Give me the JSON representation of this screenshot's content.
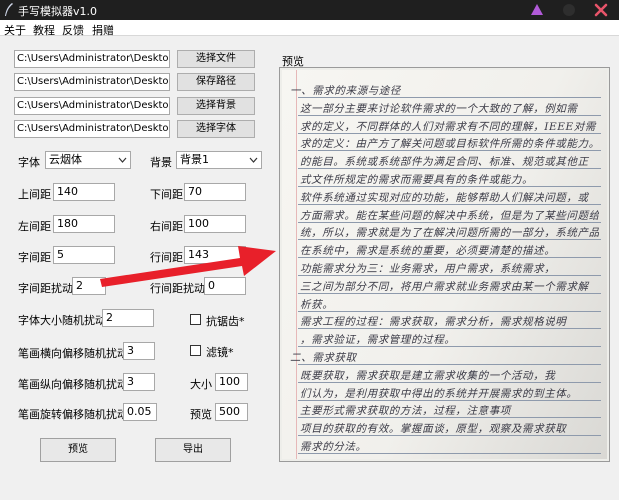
{
  "window": {
    "title": "手写模拟器v1.0"
  },
  "menu": [
    "关于",
    "教程",
    "反馈",
    "捐赠"
  ],
  "files": {
    "rows": [
      {
        "path": "C:\\Users\\Administrator\\Desktop\\我的",
        "button": "选择文件"
      },
      {
        "path": "C:\\Users\\Administrator\\Desktop",
        "button": "保存路径"
      },
      {
        "path": "C:\\Users\\Administrator\\Desktop\\【手",
        "button": "选择背景"
      },
      {
        "path": "C:\\Users\\Administrator\\Desktop\\【手",
        "button": "选择字体"
      }
    ]
  },
  "settings": {
    "font_label": "字体",
    "font_value": "云烟体",
    "bg_label": "背景",
    "bg_value": "背景1",
    "top_margin_label": "上间距",
    "top_margin": "140",
    "bottom_margin_label": "下间距",
    "bottom_margin": "70",
    "left_margin_label": "左间距",
    "left_margin": "180",
    "right_margin_label": "右间距",
    "right_margin": "100",
    "char_spacing_label": "字间距",
    "char_spacing": "5",
    "line_spacing_label": "行间距",
    "line_spacing": "143",
    "char_jitter_label": "字间距扰动",
    "char_jitter": "2",
    "line_jitter_label": "行间距扰动",
    "line_jitter": "0",
    "font_size_jitter_label": "字体大小随机扰动",
    "font_size_jitter": "2",
    "antialias_label": "抗锯齿*",
    "filter_label": "滤镜*",
    "stroke_h_label": "笔画横向偏移随机扰动",
    "stroke_h": "3",
    "stroke_v_label": "笔画纵向偏移随机扰动",
    "stroke_v": "3",
    "size_label": "大小",
    "size": "100",
    "stroke_rot_label": "笔画旋转偏移随机扰动",
    "stroke_rot": "0.05",
    "preview_label": "预览",
    "preview_value": "500"
  },
  "actions": {
    "preview": "预览",
    "export": "导出"
  },
  "preview": {
    "label": "预览",
    "lines": [
      "一、需求的来源与途径",
      "这一部分主要来讨论软件需求的一个大致的了解，例如需",
      "求的定义，不同群体的人们对需求有不同的理解，IEEE对需",
      "求的定义：由产方了解关问题或目标软件所需的条件或能力。",
      "的能目。系统或系统部件为满足合同、标准、规范或其他正",
      "式文件所规定的需求而需要具有的条件或能力。",
      "软件系统通过实现对应的功能，能够帮助人们解决问题，或",
      "方面需求。能在某些问题的解决中系统，但是为了某些问题给户系",
      "统，所以，需求就是为了在解决问题所需的一部分，系统产品",
      "在系统中，需求是系统的重要，必须要清楚的描述。",
      "功能需求分为三：业务需求，用户需求，系统需求，",
      "三之间为部分不同，将用户需求就业务需求由某一个需求解",
      "析获。",
      "需求工程的过程：需求获取，需求分析，需求规格说明",
      "，需求验证，需求管理的过程。",
      "二、需求获取",
      "既要获取，需求获取是建立需求收集的一个活动，我",
      "们认为，是利用获取中得出的系统并开展需求的到主体。",
      "主要形式需求获取的方法，过程，注意事项",
      "项目的获取的有效。掌握面谈，原型，观察及需求获取",
      "需求的分法。"
    ]
  }
}
